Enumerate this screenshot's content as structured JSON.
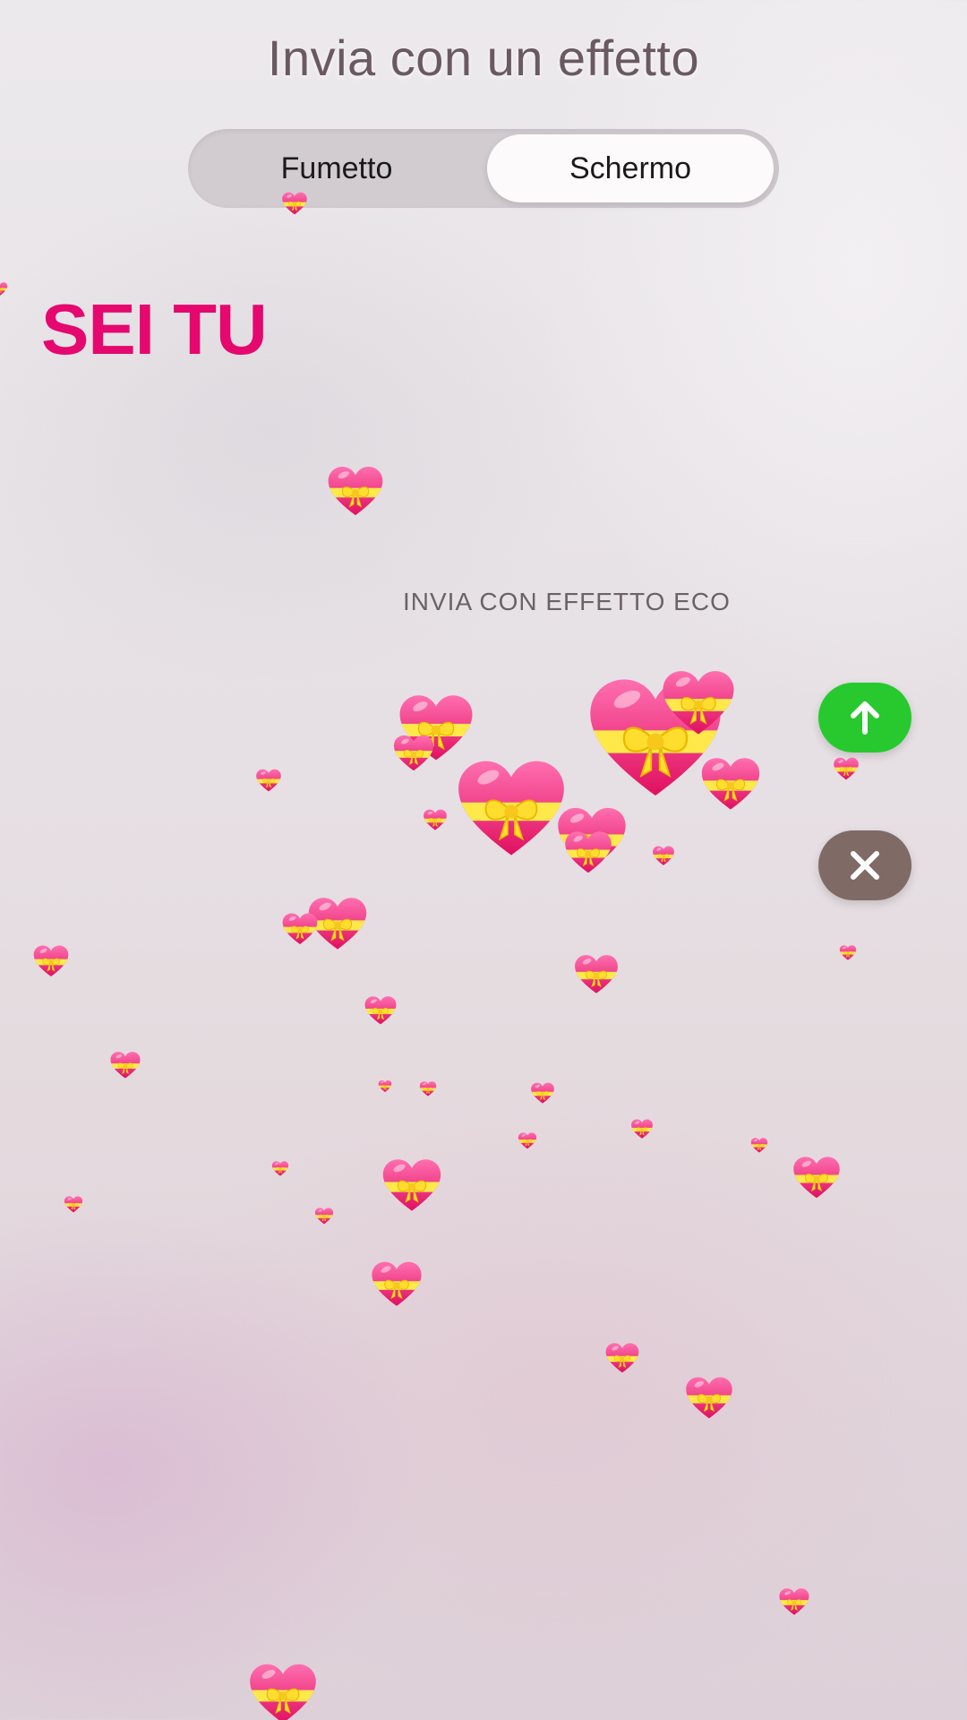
{
  "header": {
    "title": "Invia con un effetto"
  },
  "tabs": [
    {
      "label": "Fumetto",
      "selected": false
    },
    {
      "label": "Schermo",
      "selected": true
    }
  ],
  "preview": {
    "message": "SEI TU",
    "message_color": "#e5086e",
    "effect_label": "INVIA CON EFFETTO ECO"
  },
  "actions": {
    "send_icon": "arrow-up-icon",
    "send_color": "#27c92e",
    "cancel_icon": "close-icon",
    "cancel_color": "#7f6a66"
  },
  "effect_emoji": "heart-with-ribbon"
}
